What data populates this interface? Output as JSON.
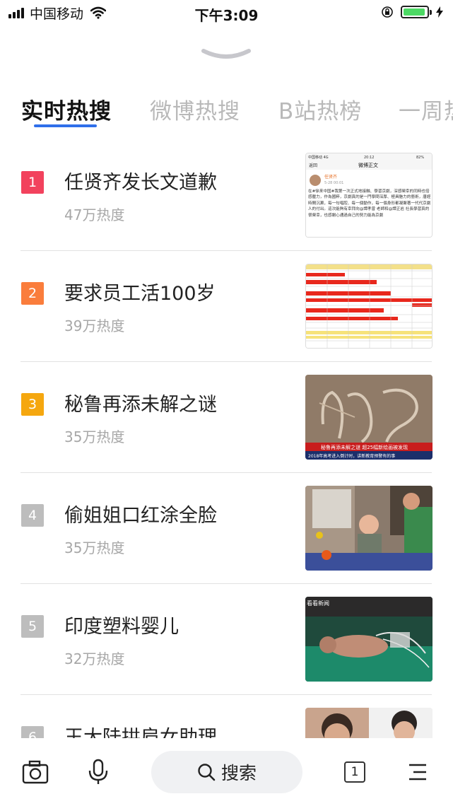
{
  "status_bar": {
    "carrier": "中国移动",
    "time": "下午3:09",
    "battery_level": 0.95,
    "battery_color": "#4cd964"
  },
  "tabs": [
    {
      "label": "实时热搜",
      "active": true
    },
    {
      "label": "微博热搜",
      "active": false
    },
    {
      "label": "B站热榜",
      "active": false
    },
    {
      "label": "一周热",
      "active": false
    }
  ],
  "accent_color": "#2f6fea",
  "items": [
    {
      "rank": "1",
      "title": "任贤齐发长文道歉",
      "heat": "47万热度",
      "badge_color": "#f2425d",
      "thumbnail": "weibo-post-screenshot"
    },
    {
      "rank": "2",
      "title": "要求员工活100岁",
      "heat": "39万热度",
      "badge_color": "#fa7d3c",
      "thumbnail": "spreadsheet-screenshot"
    },
    {
      "rank": "3",
      "title": "秘鲁再添未解之谜",
      "heat": "35万热度",
      "badge_color": "#f5a70f",
      "thumbnail": "nazca-lines-photo"
    },
    {
      "rank": "4",
      "title": "偷姐姐口红涂全脸",
      "heat": "35万热度",
      "badge_color": "#bdbdbd",
      "thumbnail": "child-photo"
    },
    {
      "rank": "5",
      "title": "印度塑料婴儿",
      "heat": "32万热度",
      "badge_color": "#bdbdbd",
      "thumbnail": "newborn-photo"
    },
    {
      "rank": "6",
      "title": "王大陆拱肩女助理",
      "heat": "",
      "badge_color": "#bdbdbd",
      "thumbnail": "celebrity-photo"
    }
  ],
  "thumb_texts": {
    "t1_carrier": "中国移动 4G",
    "t1_time": "20:12",
    "t1_battery": "82%",
    "t1_back": "返回",
    "t1_header": "微博正文",
    "t1_user": "任贤齐",
    "t1_date": "5-28 00:01",
    "t1_body": "在#徐来中国#我第一次正式地接触、學習京劇，深感榮幸的同時也倍感壓力，作為國粹，京劇真的是一門學問深厚、極具魅力的藝術，唐經時間沉澱，每一句唱腔、每一個動作，每一個身形都凝聚著一代代京劇人的付出。這次能夠有幸拜向@譚孝曾 老師和@譚正岩 社長學習真的很榮幸，也感謝心通過自己的努力能為京劇",
    "t3_caption": "秘鲁再添未解之谜 超25幅新绘画被发现",
    "t3_ticker": "2018年高考进入倒计时，讲新教育预警有的事",
    "t5_tag": "看看新闻"
  },
  "toolbar": {
    "search_label": "搜索",
    "tab_count": "1"
  }
}
